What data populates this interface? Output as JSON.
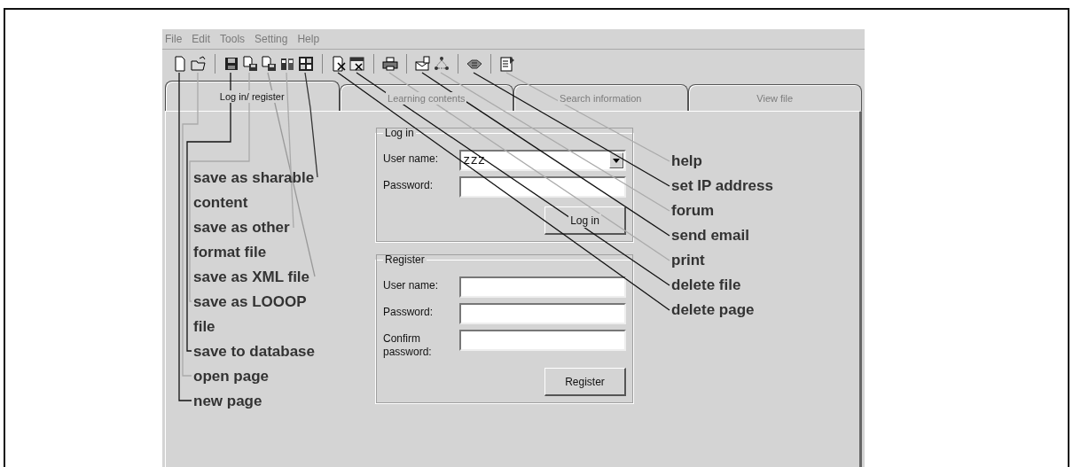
{
  "menu": [
    "File",
    "Edit",
    "Tools",
    "Setting",
    "Help"
  ],
  "tabs": [
    {
      "label": "Log in/ register",
      "selected": true
    },
    {
      "label": "Learning contents",
      "selected": false
    },
    {
      "label": "Search information",
      "selected": false
    },
    {
      "label": "View file",
      "selected": false
    }
  ],
  "login": {
    "title": "Log in",
    "fields": [
      {
        "label": "User name:",
        "kind": "combo",
        "value": "zzz"
      },
      {
        "label": "Password:",
        "kind": "text"
      }
    ],
    "button": "Log in"
  },
  "register": {
    "title": "Register",
    "fields": [
      {
        "label": "User name:",
        "kind": "text"
      },
      {
        "label": "Password:",
        "kind": "text"
      },
      {
        "label": "Confirm password:",
        "kind": "text"
      }
    ],
    "button": "Register"
  },
  "callouts_left": [
    "save as sharable\ncontent",
    "save as other\nformat file",
    "save as XML file",
    "save as LOOOP\nfile",
    "save to database",
    "open page",
    "new page"
  ],
  "callouts_right": [
    "help",
    "set IP address",
    "forum",
    "send email",
    "print",
    "delete file",
    "delete page"
  ]
}
